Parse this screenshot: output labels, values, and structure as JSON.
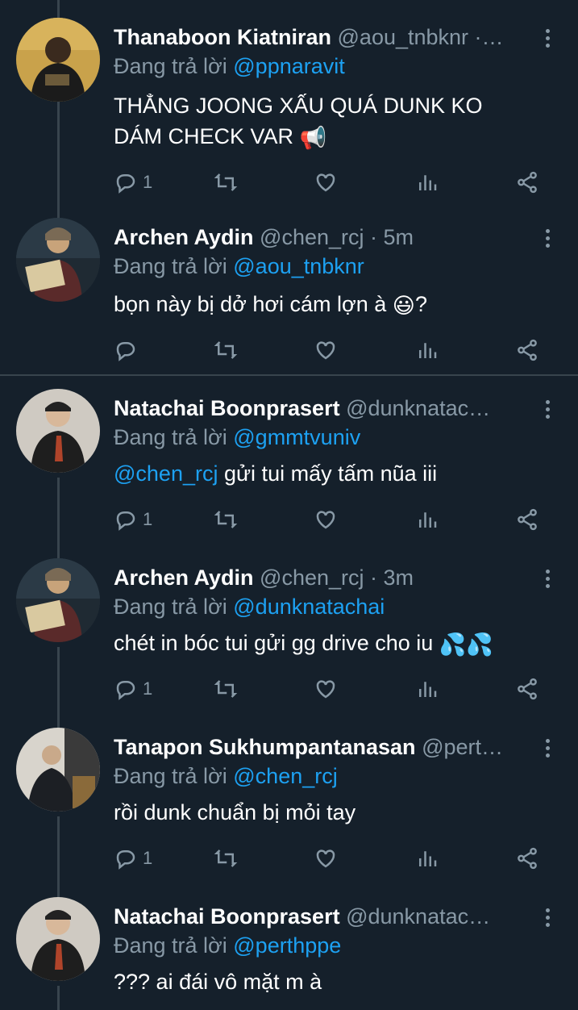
{
  "tweets": [
    {
      "name": "Thanaboon Kiatniran",
      "handle": "@aou_tnbknr ·…",
      "replying_label": "Đang trả lời ",
      "replying_to": "@ppnaravit",
      "text_line1": "THẲNG JOONG XẤU QUÁ DUNK KO",
      "text_line2": "DÁM CHECK VAR ",
      "text_emoji": "📢",
      "reply_count": "1",
      "avatar_icon": "avatar-thanaboon"
    },
    {
      "name": "Archen Aydin",
      "handle": "@chen_rcj · 5m",
      "replying_label": "Đang trả lời ",
      "replying_to": "@aou_tnbknr",
      "text": "bọn này bị dở hơi cám lợn à ",
      "text_emoji": "😃",
      "text_after": "?",
      "reply_count": "",
      "avatar_icon": "avatar-archen"
    },
    {
      "name": "Natachai Boonprasert",
      "handle": "@dunknatac…",
      "replying_label": "Đang trả lời ",
      "replying_to": "@gmmtvuniv",
      "mention": "@chen_rcj",
      "text": " gửi tui mấy tấm nũa iii",
      "reply_count": "1",
      "avatar_icon": "avatar-natachai"
    },
    {
      "name": "Archen Aydin",
      "handle": "@chen_rcj · 3m",
      "replying_label": "Đang trả lời ",
      "replying_to": "@dunknatachai",
      "text": "chét in bóc tui gửi gg drive cho iu ",
      "text_emoji": "💦💦",
      "reply_count": "1",
      "avatar_icon": "avatar-archen"
    },
    {
      "name": "Tanapon Sukhumpantanasan",
      "handle": "@pert…",
      "replying_label": "Đang trả lời ",
      "replying_to": "@chen_rcj",
      "text": "rồi dunk chuẩn bị mỏi tay",
      "reply_count": "1",
      "avatar_icon": "avatar-tanapon"
    },
    {
      "name": "Natachai Boonprasert",
      "handle": "@dunknatac…",
      "replying_label": "Đang trả lời ",
      "replying_to": "@perthppe",
      "text": "??? ai đái vô mặt m à",
      "reply_count": "",
      "avatar_icon": "avatar-natachai"
    }
  ],
  "colors": {
    "background": "#15202b",
    "text": "#ffffff",
    "muted": "#8899a6",
    "link": "#1da1f2",
    "divider": "#38444d"
  },
  "icons": [
    "reply-icon",
    "retweet-icon",
    "like-icon",
    "stats-icon",
    "share-icon",
    "more-icon"
  ]
}
